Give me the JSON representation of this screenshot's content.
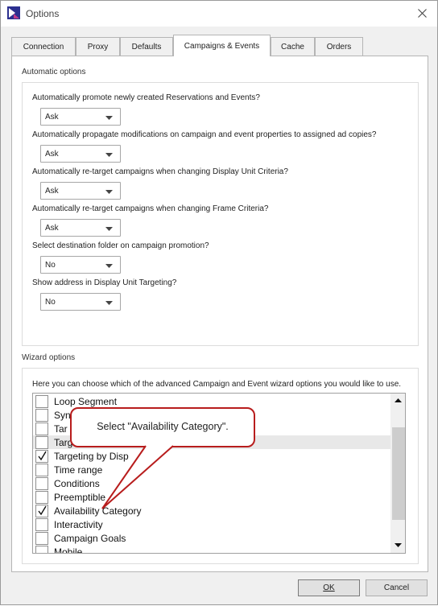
{
  "window": {
    "title": "Options",
    "close_icon": "close-icon",
    "app_icon": "app-logo-icon"
  },
  "tabs": [
    {
      "label": "Connection",
      "active": false
    },
    {
      "label": "Proxy",
      "active": false
    },
    {
      "label": "Defaults",
      "active": false
    },
    {
      "label": "Campaigns & Events",
      "active": true
    },
    {
      "label": "Cache",
      "active": false
    },
    {
      "label": "Orders",
      "active": false
    }
  ],
  "automatic": {
    "group_label": "Automatic options",
    "options": [
      {
        "question": "Automatically promote newly created Reservations and Events?",
        "value": "Ask"
      },
      {
        "question": "Automatically propagate modifications on campaign and event properties to assigned ad copies?",
        "value": "Ask"
      },
      {
        "question": "Automatically re-target campaigns when changing Display Unit Criteria?",
        "value": "Ask"
      },
      {
        "question": "Automatically re-target campaigns when changing Frame Criteria?",
        "value": "Ask"
      },
      {
        "question": "Select destination folder on campaign promotion?",
        "value": "No"
      },
      {
        "question": "Show address in Display Unit Targeting?",
        "value": "No"
      }
    ]
  },
  "wizard": {
    "group_label": "Wizard options",
    "intro": "Here you can choose which of the advanced Campaign and Event wizard options you would like to use.",
    "items": [
      {
        "label": "Loop Segment",
        "checked": false
      },
      {
        "label": "Syn",
        "checked": false
      },
      {
        "label": "Tar",
        "checked": false
      },
      {
        "label": "Targ",
        "checked": false
      },
      {
        "label": "Targeting by Disp",
        "checked": true
      },
      {
        "label": "Time range",
        "checked": false
      },
      {
        "label": "Conditions",
        "checked": false
      },
      {
        "label": "Preemptible",
        "checked": false
      },
      {
        "label": "Availability Category",
        "checked": true
      },
      {
        "label": "Interactivity",
        "checked": false
      },
      {
        "label": "Campaign Goals",
        "checked": false
      },
      {
        "label": "Mobile",
        "checked": false
      }
    ]
  },
  "callout": {
    "text": "Select \"Availability Category\".",
    "border_color": "#b81d1d"
  },
  "buttons": {
    "ok": "OK",
    "cancel": "Cancel"
  }
}
